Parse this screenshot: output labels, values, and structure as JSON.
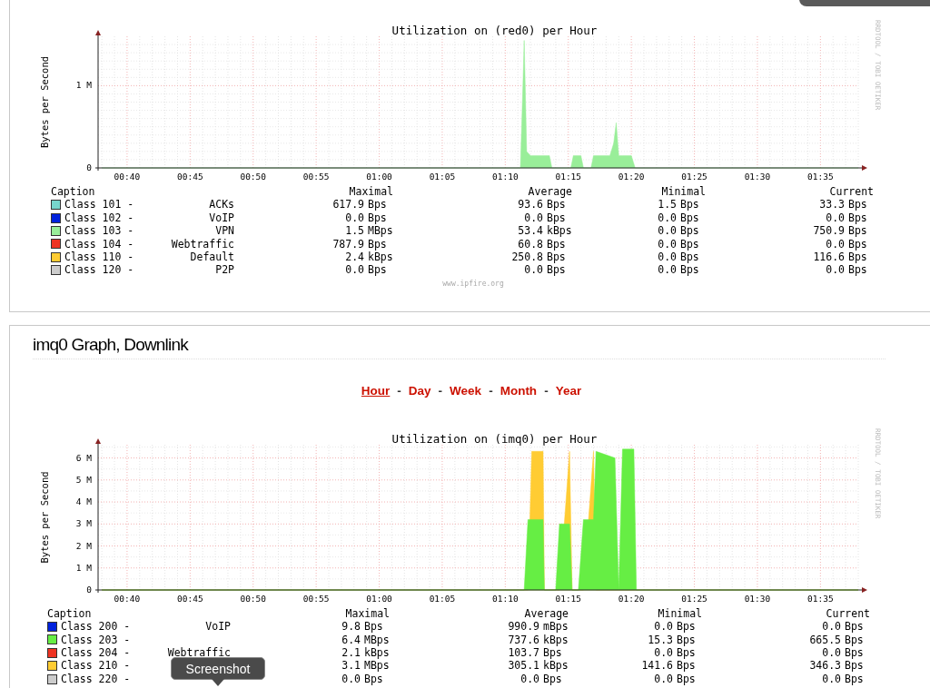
{
  "upper_panel": {
    "graph": {
      "credit": "RRDTOOL / TOBI OETIKER",
      "chart_data": {
        "type": "area",
        "title": "Utilization on (red0) per Hour",
        "ylabel": "Bytes per Second",
        "x": [
          38,
          71.2,
          71.4,
          71.5,
          71.7,
          72.0,
          73.5,
          73.7,
          75.2,
          75.4,
          76.0,
          76.2,
          76.8,
          77.0,
          78.3,
          78.6,
          78.8,
          79.0,
          79.3,
          80.0,
          80.3,
          98
        ],
        "grid": true,
        "series": [
          {
            "color": "#99ee99",
            "values": [
              0,
              0,
              1000000,
              1550000,
              200000,
              150000,
              150000,
              0,
              0,
              150000,
              150000,
              0,
              0,
              150000,
              150000,
              300000,
              550000,
              150000,
              150000,
              150000,
              0,
              0
            ]
          }
        ],
        "xlim": [
          37.7,
          98
        ],
        "ylim": [
          0,
          1600000
        ],
        "xticks": [
          {
            "value": 40,
            "label": "00:40"
          },
          {
            "value": 45,
            "label": "00:45"
          },
          {
            "value": 50,
            "label": "00:50"
          },
          {
            "value": 55,
            "label": "00:55"
          },
          {
            "value": 60,
            "label": "01:00"
          },
          {
            "value": 65,
            "label": "01:05"
          },
          {
            "value": 70,
            "label": "01:10"
          },
          {
            "value": 75,
            "label": "01:15"
          },
          {
            "value": 80,
            "label": "01:20"
          },
          {
            "value": 85,
            "label": "01:25"
          },
          {
            "value": 90,
            "label": "01:30"
          },
          {
            "value": 95,
            "label": "01:35"
          }
        ],
        "yticks": [
          {
            "value": 0,
            "label": "0"
          },
          {
            "value": 1000000,
            "label": "1 M"
          }
        ]
      }
    },
    "legend": {
      "columns": [
        "Caption",
        "Maximal",
        "Average",
        "Minimal",
        "Current"
      ],
      "rows": [
        {
          "name": "Class 101 -",
          "label": "ACKs",
          "color": "#77d6cc",
          "maximal": {
            "value": "617.9",
            "unit": "Bps"
          },
          "average": {
            "value": "93.6",
            "unit": "Bps"
          },
          "minimal": {
            "value": "1.5",
            "unit": "Bps"
          },
          "current": {
            "value": "33.3",
            "unit": "Bps"
          }
        },
        {
          "name": "Class 102 -",
          "label": "VoIP",
          "color": "#0022dd",
          "maximal": {
            "value": "0.0",
            "unit": "Bps"
          },
          "average": {
            "value": "0.0",
            "unit": "Bps"
          },
          "minimal": {
            "value": "0.0",
            "unit": "Bps"
          },
          "current": {
            "value": "0.0",
            "unit": "Bps"
          }
        },
        {
          "name": "Class 103 -",
          "label": "VPN",
          "color": "#99ee99",
          "maximal": {
            "value": "1.5",
            "unit": "MBps"
          },
          "average": {
            "value": "53.4",
            "unit": "kBps"
          },
          "minimal": {
            "value": "0.0",
            "unit": "Bps"
          },
          "current": {
            "value": "750.9",
            "unit": "Bps"
          }
        },
        {
          "name": "Class 104 -",
          "label": "Webtraffic",
          "color": "#ee3322",
          "maximal": {
            "value": "787.9",
            "unit": "Bps"
          },
          "average": {
            "value": "60.8",
            "unit": "Bps"
          },
          "minimal": {
            "value": "0.0",
            "unit": "Bps"
          },
          "current": {
            "value": "0.0",
            "unit": "Bps"
          }
        },
        {
          "name": "Class 110 -",
          "label": "Default",
          "color": "#ffcc33",
          "maximal": {
            "value": "2.4",
            "unit": "kBps"
          },
          "average": {
            "value": "250.8",
            "unit": "Bps"
          },
          "minimal": {
            "value": "0.0",
            "unit": "Bps"
          },
          "current": {
            "value": "116.6",
            "unit": "Bps"
          }
        },
        {
          "name": "Class 120 -",
          "label": "P2P",
          "color": "#cccccc",
          "maximal": {
            "value": "0.0",
            "unit": "Bps"
          },
          "average": {
            "value": "0.0",
            "unit": "Bps"
          },
          "minimal": {
            "value": "0.0",
            "unit": "Bps"
          },
          "current": {
            "value": "0.0",
            "unit": "Bps"
          }
        }
      ]
    },
    "footer": "www.ipfire.org"
  },
  "lower_panel": {
    "heading": "imq0 Graph, Downlink",
    "periods": [
      {
        "label": "Hour",
        "selected": true
      },
      {
        "label": "Day",
        "selected": false
      },
      {
        "label": "Week",
        "selected": false
      },
      {
        "label": "Month",
        "selected": false
      },
      {
        "label": "Year",
        "selected": false
      }
    ],
    "period_separators": [
      "-",
      "-",
      "-",
      "-"
    ],
    "graph": {
      "credit": "RRDTOOL / TOBI OETIKER",
      "chart_data": {
        "type": "area",
        "title": "Utilization on (imq0) per Hour",
        "ylabel": "Bytes per Second",
        "stacked": false,
        "x": [
          38,
          71.5,
          71.8,
          72.1,
          73.0,
          73.1,
          74.0,
          74.3,
          75.1,
          75.3,
          75.8,
          76.2,
          77.0,
          77.2,
          78.7,
          79.0,
          79.3,
          80.2,
          80.4,
          98
        ],
        "grid": true,
        "series": [
          {
            "color": "#66ee44",
            "values": [
              0,
              0,
              3200000,
              3200000,
              3200000,
              0,
              0,
              3000000,
              3000000,
              0,
              0,
              3200000,
              3200000,
              6300000,
              6000000,
              0,
              6400000,
              6400000,
              0,
              0
            ]
          },
          {
            "color": "#ffcc33",
            "values": [
              0,
              0,
              0,
              6300000,
              6300000,
              0,
              0,
              0,
              6300000,
              0,
              0,
              0,
              6300000,
              0,
              0,
              0,
              0,
              0,
              0,
              0
            ]
          }
        ],
        "xlim": [
          37.7,
          98
        ],
        "ylim": [
          0,
          6600000
        ],
        "xticks": [
          {
            "value": 40,
            "label": "00:40"
          },
          {
            "value": 45,
            "label": "00:45"
          },
          {
            "value": 50,
            "label": "00:50"
          },
          {
            "value": 55,
            "label": "00:55"
          },
          {
            "value": 60,
            "label": "01:00"
          },
          {
            "value": 65,
            "label": "01:05"
          },
          {
            "value": 70,
            "label": "01:10"
          },
          {
            "value": 75,
            "label": "01:15"
          },
          {
            "value": 80,
            "label": "01:20"
          },
          {
            "value": 85,
            "label": "01:25"
          },
          {
            "value": 90,
            "label": "01:30"
          },
          {
            "value": 95,
            "label": "01:35"
          }
        ],
        "yticks": [
          {
            "value": 0,
            "label": "0"
          },
          {
            "value": 1000000,
            "label": "1 M"
          },
          {
            "value": 2000000,
            "label": "2 M"
          },
          {
            "value": 3000000,
            "label": "3 M"
          },
          {
            "value": 4000000,
            "label": "4 M"
          },
          {
            "value": 5000000,
            "label": "5 M"
          },
          {
            "value": 6000000,
            "label": "6 M"
          }
        ]
      }
    },
    "legend": {
      "columns": [
        "Caption",
        "Maximal",
        "Average",
        "Minimal",
        "Current"
      ],
      "rows": [
        {
          "name": "Class 200 -",
          "label": "VoIP",
          "color": "#0022dd",
          "maximal": {
            "value": "9.8",
            "unit": "Bps"
          },
          "average": {
            "value": "990.9",
            "unit": "mBps"
          },
          "minimal": {
            "value": "0.0",
            "unit": "Bps"
          },
          "current": {
            "value": "0.0",
            "unit": "Bps"
          }
        },
        {
          "name": "Class 203 -",
          "color": "#66ee44",
          "maximal": {
            "value": "6.4",
            "unit": "MBps"
          },
          "average": {
            "value": "737.6",
            "unit": "kBps"
          },
          "minimal": {
            "value": "15.3",
            "unit": "Bps"
          },
          "current": {
            "value": "665.5",
            "unit": "Bps"
          }
        },
        {
          "name": "Class 204 -",
          "label": "Webtraffic",
          "color": "#ee3322",
          "maximal": {
            "value": "2.1",
            "unit": "kBps"
          },
          "average": {
            "value": "103.7",
            "unit": "Bps"
          },
          "minimal": {
            "value": "0.0",
            "unit": "Bps"
          },
          "current": {
            "value": "0.0",
            "unit": "Bps"
          }
        },
        {
          "name": "Class 210 -",
          "color": "#ffcc33",
          "maximal": {
            "value": "3.1",
            "unit": "MBps"
          },
          "average": {
            "value": "305.1",
            "unit": "kBps"
          },
          "minimal": {
            "value": "141.6",
            "unit": "Bps"
          },
          "current": {
            "value": "346.3",
            "unit": "Bps"
          }
        },
        {
          "name": "Class 220 -",
          "color": "#cccccc",
          "maximal": {
            "value": "0.0",
            "unit": "Bps"
          },
          "average": {
            "value": "0.0",
            "unit": "Bps"
          },
          "minimal": {
            "value": "0.0",
            "unit": "Bps"
          },
          "current": {
            "value": "0.0",
            "unit": "Bps"
          }
        }
      ]
    }
  },
  "tooltip": "Screenshot"
}
